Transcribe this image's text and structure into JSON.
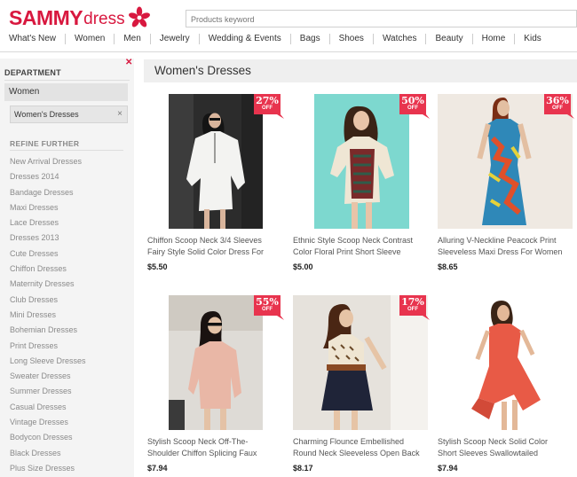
{
  "brand": {
    "main": "SAMMY",
    "sub": "dress"
  },
  "search": {
    "placeholder": "Products keyword"
  },
  "nav": [
    "What's New",
    "Women",
    "Men",
    "Jewelry",
    "Wedding & Events",
    "Bags",
    "Shoes",
    "Watches",
    "Beauty",
    "Home",
    "Kids"
  ],
  "sidebar": {
    "heading": "DEPARTMENT",
    "department": "Women",
    "active_filter": "Women's Dresses",
    "refine_heading": "REFINE FURTHER",
    "categories": [
      "New Arrival Dresses",
      "Dresses 2014",
      "Bandage Dresses",
      "Maxi Dresses",
      "Lace Dresses",
      "Dresses 2013",
      "Cute Dresses",
      "Chiffon Dresses",
      "Maternity Dresses",
      "Club Dresses",
      "Mini Dresses",
      "Bohemian Dresses",
      "Print Dresses",
      "Long Sleeve Dresses",
      "Sweater Dresses",
      "Summer Dresses",
      "Casual Dresses",
      "Vintage Dresses",
      "Bodycon Dresses",
      "Black Dresses",
      "Plus Size Dresses"
    ]
  },
  "main": {
    "title": "Women's Dresses"
  },
  "products": [
    {
      "name_line1": "Chiffon Scoop Neck 3/4 Sleeves",
      "name_line2": "Fairy Style Solid Color Dress For",
      "price": "$5.50",
      "discount": "27%",
      "discount_label": "OFF"
    },
    {
      "name_line1": "Ethnic Style Scoop Neck Contrast",
      "name_line2": "Color Floral Print Short Sleeve",
      "price": "$5.00",
      "discount": "50%",
      "discount_label": "OFF"
    },
    {
      "name_line1": "Alluring V-Neckline Peacock Print",
      "name_line2": "Sleeveless Maxi Dress For Women",
      "price": "$8.65",
      "discount": "36%",
      "discount_label": "OFF"
    },
    {
      "name_line1": "Stylish Scoop Neck Off-The-",
      "name_line2": "Shoulder Chiffon Splicing Faux",
      "price": "$7.94",
      "discount": "55%",
      "discount_label": "OFF"
    },
    {
      "name_line1": "Charming Flounce Embellished",
      "name_line2": "Round Neck Sleeveless Open Back",
      "price": "$8.17",
      "discount": "17%",
      "discount_label": "OFF"
    },
    {
      "name_line1": "Stylish Scoop Neck Solid Color",
      "name_line2": "Short Sleeves Swallowtailed",
      "price": "$7.94",
      "discount": "",
      "discount_label": ""
    }
  ],
  "colors": {
    "brand_red": "#d8183f",
    "badge_red": "#e8344e"
  }
}
